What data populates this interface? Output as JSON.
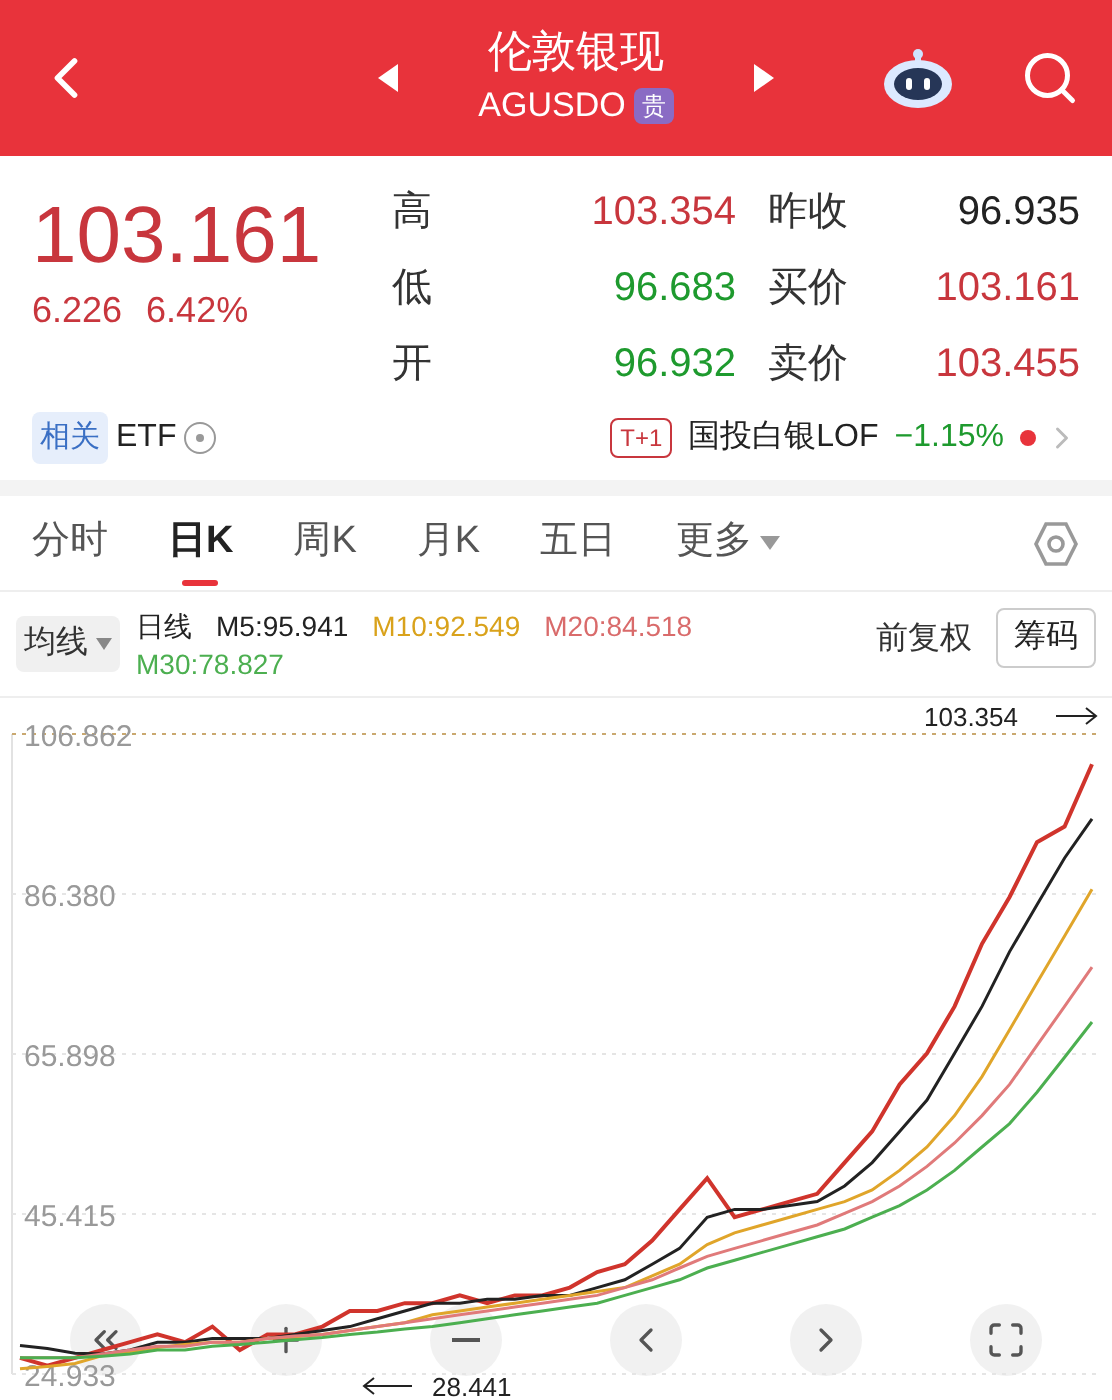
{
  "header": {
    "title": "伦敦银现",
    "symbol": "AGUSDO",
    "badge": "贵"
  },
  "quote": {
    "price": "103.161",
    "change": "6.226",
    "change_pct": "6.42%",
    "stats": [
      {
        "label": "高",
        "value": "103.354",
        "color": "#c8363d"
      },
      {
        "label": "昨收",
        "value": "96.935",
        "color": "#222222"
      },
      {
        "label": "低",
        "value": "96.683",
        "color": "#1e9a2e"
      },
      {
        "label": "买价",
        "value": "103.161",
        "color": "#c8363d"
      },
      {
        "label": "开",
        "value": "96.932",
        "color": "#1e9a2e"
      },
      {
        "label": "卖价",
        "value": "103.455",
        "color": "#c8363d"
      }
    ]
  },
  "related": {
    "tag": "相关",
    "label": "ETF",
    "fund_tag": "T+1",
    "fund_name": "国投白银LOF",
    "fund_change": "−1.15%"
  },
  "tabs": [
    {
      "label": "分时",
      "selected": false
    },
    {
      "label": "日K",
      "selected": true
    },
    {
      "label": "周K",
      "selected": false
    },
    {
      "label": "月K",
      "selected": false
    },
    {
      "label": "五日",
      "selected": false
    },
    {
      "label": "更多",
      "selected": false,
      "dropdown": true
    }
  ],
  "indicators": {
    "selector": "均线",
    "period": "日线",
    "values": [
      {
        "text": "M5:95.941",
        "color": "#222222"
      },
      {
        "text": "M10:92.549",
        "color": "#d9a21b"
      },
      {
        "text": "M20:84.518",
        "color": "#d96b6b"
      },
      {
        "text": "M30:78.827",
        "color": "#4caf50"
      }
    ],
    "adjust": "前复权",
    "chips_button": "筹码"
  },
  "chart": {
    "chart_data": {
      "type": "line",
      "yticks": [
        24.933,
        45.415,
        65.898,
        {
          "value": 86.38,
          "label": "86.380"
        },
        106.862
      ],
      "ylim": [
        24.933,
        106.862
      ],
      "grid": true,
      "series": [
        {
          "color": "#d0342c",
          "values": [
            27,
            26,
            27,
            28,
            29,
            30,
            29,
            31,
            28,
            30,
            30,
            31,
            33,
            33,
            34,
            34,
            35,
            34,
            35,
            35,
            36,
            38,
            39,
            42,
            46,
            50,
            45,
            46,
            47,
            48,
            52,
            56,
            62,
            66,
            72,
            80,
            86,
            93,
            95,
            103
          ]
        },
        {
          "color": "#222222",
          "values": [
            28.6,
            28.2,
            27.6,
            27.5,
            28,
            29,
            29,
            29.5,
            29.5,
            29.5,
            30,
            30.5,
            31,
            32,
            33,
            34,
            34,
            34.5,
            34.5,
            35,
            35,
            36,
            37,
            39,
            41,
            45,
            46,
            46,
            46.5,
            47,
            49,
            52,
            56,
            60,
            66,
            72,
            79,
            85,
            91,
            96
          ]
        },
        {
          "color": "#e0a52a",
          "values": [
            25.6,
            25.9,
            26.3,
            27.3,
            27.8,
            28.3,
            28.7,
            29,
            29,
            29.5,
            29.7,
            30,
            30.5,
            31,
            31.5,
            32.5,
            33,
            33.5,
            34,
            34.5,
            35,
            35.5,
            36,
            37.5,
            39,
            41.5,
            43,
            44,
            45,
            46,
            47,
            48.5,
            51,
            54,
            58,
            63,
            69,
            75,
            81,
            87
          ]
        },
        {
          "color": "#e07a7a",
          "values": [
            27,
            27,
            27,
            27.5,
            28,
            28.5,
            28.5,
            29,
            29,
            29.5,
            29.8,
            30,
            30.5,
            31,
            31.5,
            32,
            32.5,
            33,
            33.5,
            34,
            34.5,
            35,
            36,
            37,
            38.5,
            40,
            41,
            42,
            43,
            44,
            45.5,
            47,
            49,
            51.5,
            54.5,
            58,
            62,
            67,
            72,
            77
          ]
        },
        {
          "color": "#4caf50",
          "values": [
            27,
            27,
            27,
            27.2,
            27.5,
            28,
            28,
            28.5,
            28.7,
            29,
            29.3,
            29.6,
            30,
            30.3,
            30.7,
            31,
            31.5,
            32,
            32.5,
            33,
            33.5,
            34,
            35,
            36,
            37,
            38.5,
            39.5,
            40.5,
            41.5,
            42.5,
            43.5,
            45,
            46.5,
            48.5,
            51,
            54,
            57,
            61,
            65.5,
            70
          ]
        }
      ],
      "annotations": [
        {
          "text": "103.354"
        },
        {
          "text": "28.441"
        }
      ]
    }
  }
}
